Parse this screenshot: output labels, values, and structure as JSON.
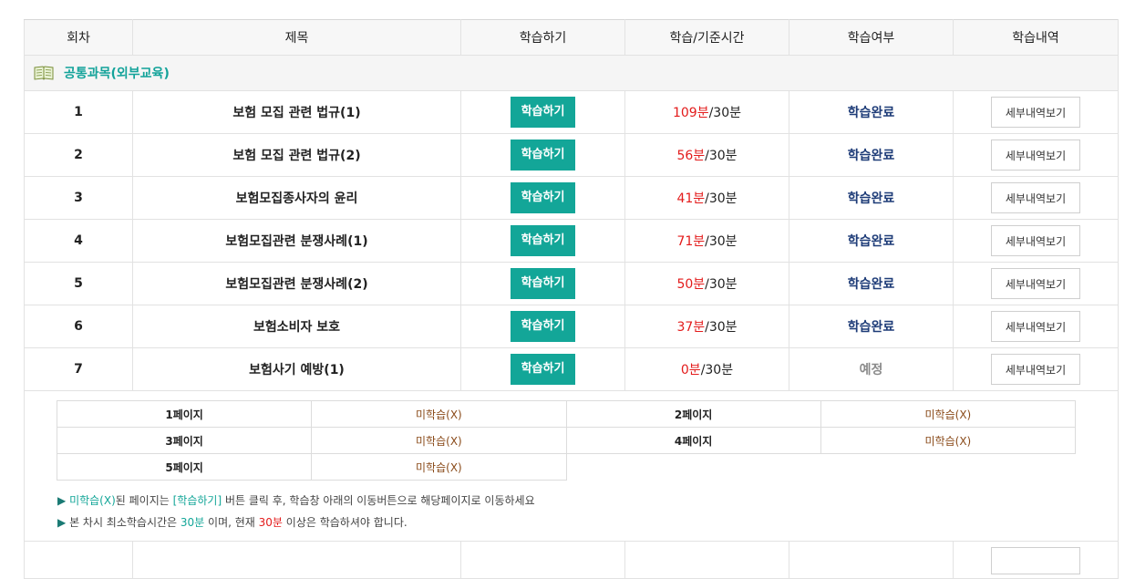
{
  "table": {
    "headers": [
      "회차",
      "제목",
      "학습하기",
      "학습/기준시간",
      "학습여부",
      "학습내역"
    ],
    "category": "공통과목(외부교육)",
    "rows": [
      {
        "num": "1",
        "title": "보험 모집 관련 법규(1)",
        "study_label": "학습하기",
        "learned": "109분",
        "base": "/30분",
        "status": "학습완료",
        "detail_label": "세부내역보기"
      },
      {
        "num": "2",
        "title": "보험 모집 관련 법규(2)",
        "study_label": "학습하기",
        "learned": "56분",
        "base": "/30분",
        "status": "학습완료",
        "detail_label": "세부내역보기"
      },
      {
        "num": "3",
        "title": "보험모집종사자의 윤리",
        "study_label": "학습하기",
        "learned": "41분",
        "base": "/30분",
        "status": "학습완료",
        "detail_label": "세부내역보기"
      },
      {
        "num": "4",
        "title": "보험모집관련 분쟁사례(1)",
        "study_label": "학습하기",
        "learned": "71분",
        "base": "/30분",
        "status": "학습완료",
        "detail_label": "세부내역보기"
      },
      {
        "num": "5",
        "title": "보험모집관련 분쟁사례(2)",
        "study_label": "학습하기",
        "learned": "50분",
        "base": "/30분",
        "status": "학습완료",
        "detail_label": "세부내역보기"
      },
      {
        "num": "6",
        "title": "보험소비자 보호",
        "study_label": "학습하기",
        "learned": "37분",
        "base": "/30분",
        "status": "학습완료",
        "detail_label": "세부내역보기"
      },
      {
        "num": "7",
        "title": "보험사기 예방(1)",
        "study_label": "학습하기",
        "learned": "0분",
        "base": "/30분",
        "status": "예정",
        "detail_label": "세부내역보기"
      }
    ]
  },
  "pages": [
    {
      "page": "1페이지",
      "state": "미학습(X)"
    },
    {
      "page": "2페이지",
      "state": "미학습(X)"
    },
    {
      "page": "3페이지",
      "state": "미학습(X)"
    },
    {
      "page": "4페이지",
      "state": "미학습(X)"
    },
    {
      "page": "5페이지",
      "state": "미학습(X)"
    }
  ],
  "notes": {
    "n1_a": "미학습(X)",
    "n1_b": "된 페이지는 ",
    "n1_c": "[학습하기]",
    "n1_d": " 버튼 클릭 후, 학습창 아래의 이동버튼으로 해당페이지로 이동하세요",
    "n2_a": "본 차시 최소학습시간은 ",
    "n2_b": "30분",
    "n2_c": " 이며, 현재 ",
    "n2_d": "30분",
    "n2_e": " 이상은 학습하셔야 합니다."
  }
}
